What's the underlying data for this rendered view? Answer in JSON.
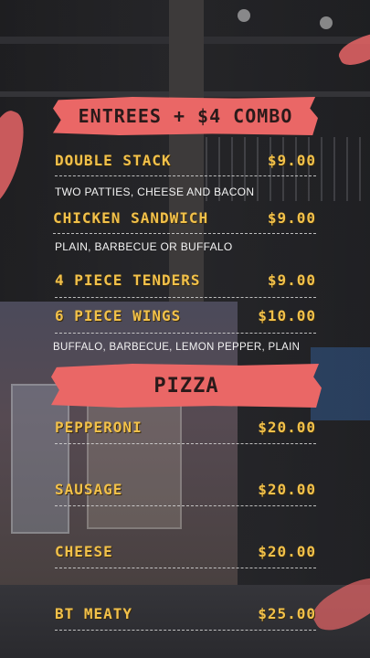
{
  "sections": {
    "combo": {
      "title": "ENTREES + $4 COMBO",
      "items": [
        {
          "name": "DOUBLE STACK",
          "price": "$9.00",
          "description": "TWO PATTIES, CHEESE AND BACON"
        },
        {
          "name": "CHICKEN SANDWICH",
          "price": "$9.00",
          "description": "PLAIN, BARBECUE OR BUFFALO"
        },
        {
          "name": "4 PIECE TENDERS",
          "price": "$9.00",
          "description": ""
        },
        {
          "name": "6 PIECE WINGS",
          "price": "$10.00",
          "description": "BUFFALO, BARBECUE, LEMON PEPPER, PLAIN"
        }
      ]
    },
    "pizza": {
      "title": "PIZZA",
      "items": [
        {
          "name": "PEPPERONI",
          "price": "$20.00"
        },
        {
          "name": "SAUSAGE",
          "price": "$20.00"
        },
        {
          "name": "CHEESE",
          "price": "$20.00"
        },
        {
          "name": "BT MEATY",
          "price": "$25.00"
        }
      ]
    }
  },
  "colors": {
    "banner": "#ea6766",
    "item_text": "#f2c14a",
    "description_text": "#f3f3f3"
  }
}
